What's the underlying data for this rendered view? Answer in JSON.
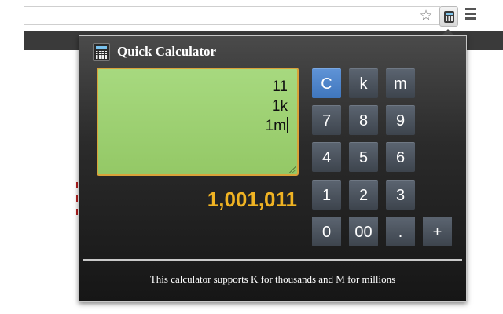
{
  "browser": {
    "icons": {
      "star": "star-outline-icon",
      "extension": "calculator-icon",
      "menu": "hamburger-menu-icon"
    }
  },
  "popup": {
    "title": "Quick Calculator",
    "input_lines": [
      "11",
      "1k",
      "1m"
    ],
    "result": "1,001,011",
    "keys": [
      "C",
      "k",
      "m",
      "7",
      "8",
      "9",
      "4",
      "5",
      "6",
      "1",
      "2",
      "3",
      "0",
      "00",
      ".",
      "+"
    ],
    "footer": "This calculator supports K for thousands and M for millions"
  },
  "colors": {
    "display_bg": "#a3d67b",
    "display_border": "#d9a23a",
    "result": "#f0b323",
    "key": "#4c545e",
    "key_active": "#4a83c9"
  }
}
